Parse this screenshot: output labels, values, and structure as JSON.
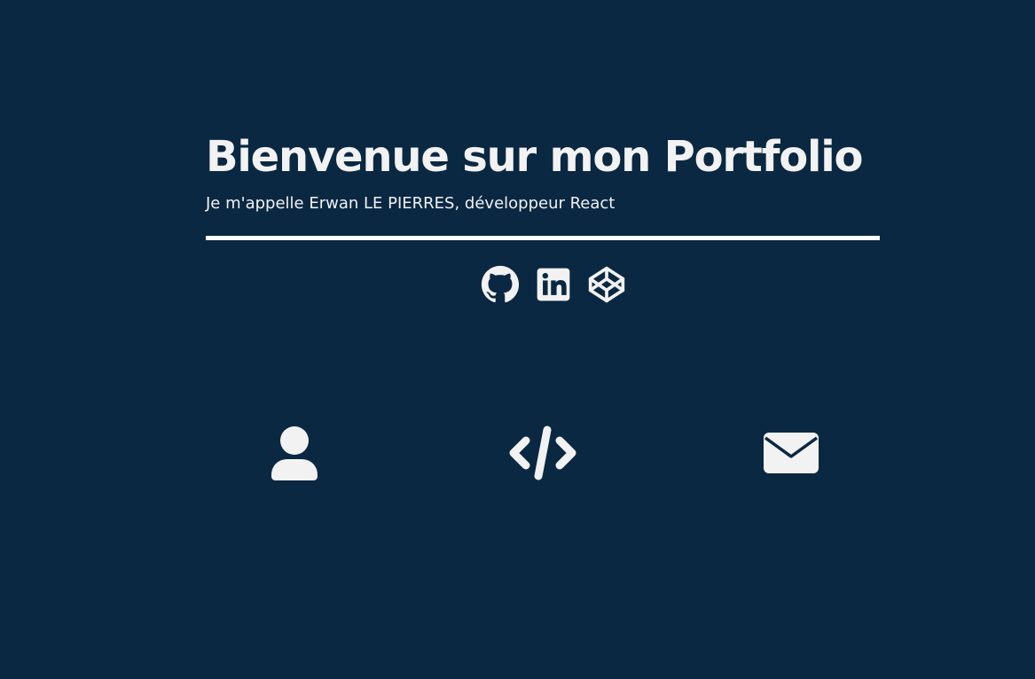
{
  "header": {
    "title": "Bienvenue sur mon Portfolio",
    "subtitle": "Je m'appelle Erwan LE PIERRES, développeur React"
  },
  "socials": [
    {
      "icon": "github-icon"
    },
    {
      "icon": "linkedin-icon"
    },
    {
      "icon": "codepen-icon"
    }
  ],
  "cards": [
    {
      "icon": "user-icon"
    },
    {
      "icon": "code-icon"
    },
    {
      "icon": "envelope-icon"
    }
  ],
  "colors": {
    "background": "#0a2842",
    "foreground": "#f2f2f2",
    "divider": "#ffffff"
  }
}
